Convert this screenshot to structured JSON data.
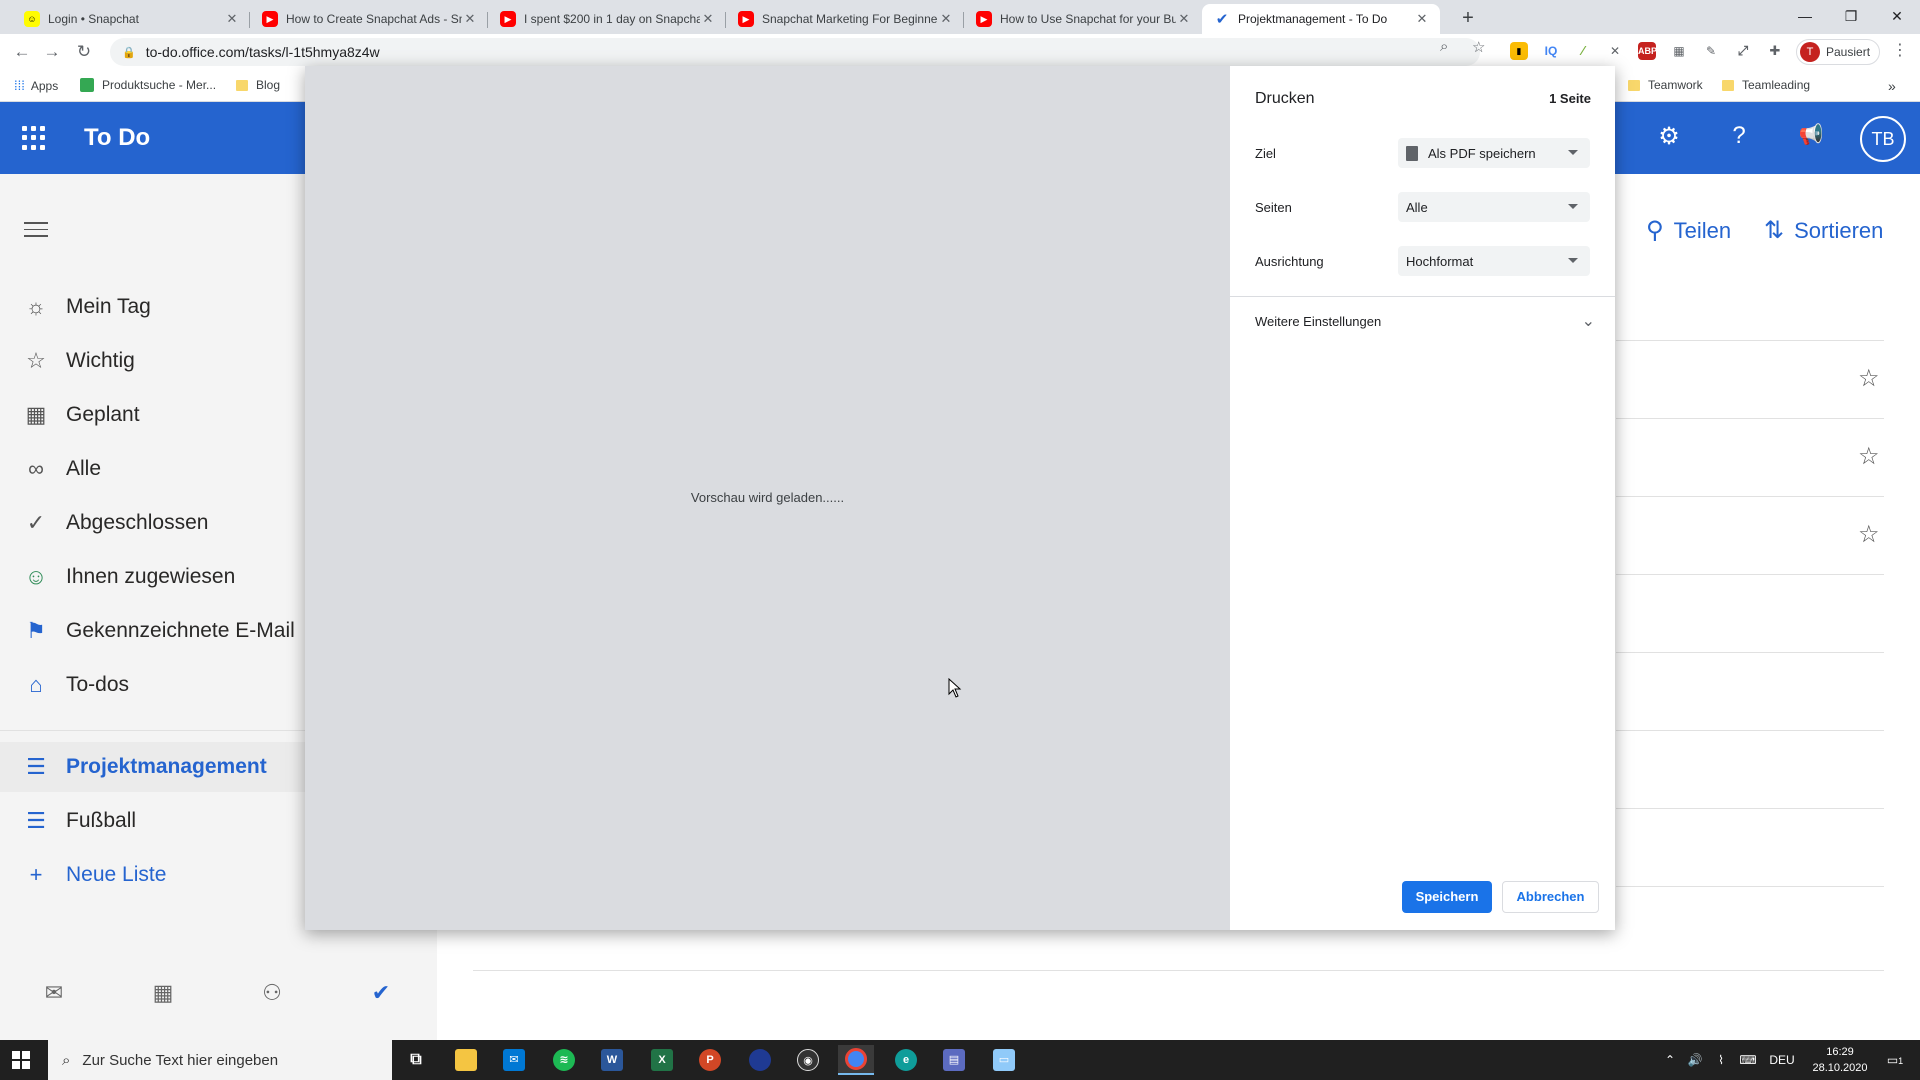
{
  "browser": {
    "tabs": [
      {
        "title": "Login • Snapchat",
        "favicon": "snapchat-icon"
      },
      {
        "title": "How to Create Snapchat Ads - Sn",
        "favicon": "youtube-icon"
      },
      {
        "title": "I spent $200 in 1 day on Snapcha",
        "favicon": "youtube-icon"
      },
      {
        "title": "Snapchat Marketing For Beginne",
        "favicon": "youtube-icon"
      },
      {
        "title": "How to Use Snapchat for your Bu",
        "favicon": "youtube-icon"
      },
      {
        "title": "Projektmanagement - To Do",
        "favicon": "todo-icon",
        "active": true
      }
    ],
    "new_tab": "+",
    "url": "to-do.office.com/tasks/l-1t5hmya8z4w",
    "profile": {
      "initial": "T",
      "label": "Pausiert"
    },
    "bookmarks": [
      {
        "label": "Apps"
      },
      {
        "label": "Produktsuche - Mer..."
      },
      {
        "label": "Blog"
      },
      {
        "label": "Teamwork"
      },
      {
        "label": "Teamleading"
      }
    ],
    "bookmarks_more": "»"
  },
  "app": {
    "title": "To Do",
    "user_initials": "TB",
    "colors": {
      "brand": "#2564cf",
      "sidebar": "#f4f4f4"
    }
  },
  "sidebar": {
    "items": [
      {
        "label": "Mein Tag",
        "icon": "sun-icon"
      },
      {
        "label": "Wichtig",
        "icon": "star-icon"
      },
      {
        "label": "Geplant",
        "icon": "calendar-icon"
      },
      {
        "label": "Alle",
        "icon": "infinity-icon"
      },
      {
        "label": "Abgeschlossen",
        "icon": "check-circle-icon"
      },
      {
        "label": "Ihnen zugewiesen",
        "icon": "person-icon"
      },
      {
        "label": "Gekennzeichnete E-Mail",
        "icon": "flag-icon"
      },
      {
        "label": "To-dos",
        "icon": "home-icon"
      }
    ],
    "lists": [
      {
        "label": "Projektmanagement",
        "icon": "list-icon",
        "active": true
      },
      {
        "label": "Fußball",
        "icon": "list-icon"
      }
    ],
    "new_list": "Neue Liste"
  },
  "main": {
    "share": "Teilen",
    "sort": "Sortieren"
  },
  "print": {
    "title": "Drucken",
    "pages_count": "1 Seite",
    "preview_message": "Vorschau wird geladen......",
    "destination": {
      "label": "Ziel",
      "value": "Als PDF speichern"
    },
    "pages": {
      "label": "Seiten",
      "value": "Alle"
    },
    "orientation": {
      "label": "Ausrichtung",
      "value": "Hochformat"
    },
    "more_settings": "Weitere Einstellungen",
    "save": "Speichern",
    "cancel": "Abbrechen",
    "colors": {
      "primary": "#1a73e8",
      "preview_bg": "#dadce0"
    }
  },
  "taskbar": {
    "search_placeholder": "Zur Suche Text hier eingeben",
    "language": "DEU",
    "time": "16:29",
    "date": "28.10.2020",
    "notification_count": "1"
  }
}
